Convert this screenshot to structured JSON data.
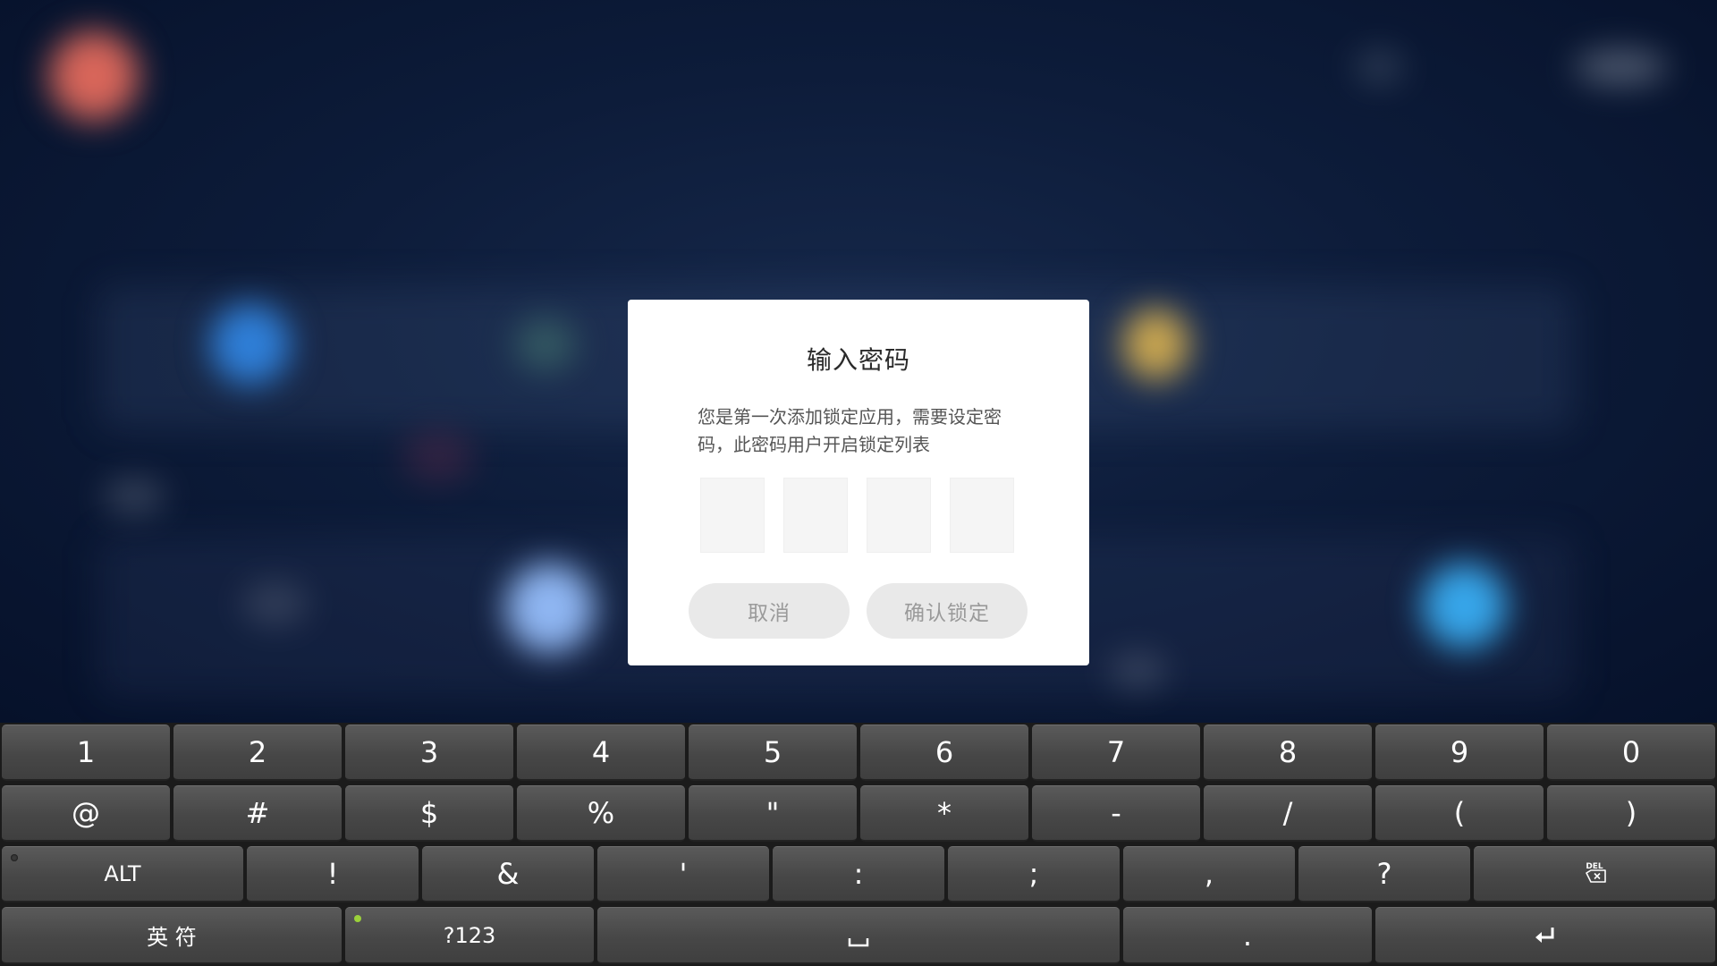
{
  "dialog": {
    "title": "输入密码",
    "message": "您是第一次添加锁定应用，需要设定密码，此密码用户开启锁定列表",
    "pin_boxes": [
      "",
      "",
      "",
      ""
    ],
    "cancel_label": "取消",
    "confirm_label": "确认锁定"
  },
  "keyboard": {
    "row1": [
      "1",
      "2",
      "3",
      "4",
      "5",
      "6",
      "7",
      "8",
      "9",
      "0"
    ],
    "row2": [
      "@",
      "#",
      "$",
      "%",
      "\"",
      "*",
      "-",
      "/",
      "(",
      ")"
    ],
    "row3": {
      "alt": "ALT",
      "symbols": [
        "!",
        "&",
        "'",
        ":",
        ";",
        ",",
        "?"
      ],
      "delete_icon": "delete-icon"
    },
    "row4": {
      "lang": "英 符",
      "mode": "?123",
      "space_icon": "space-icon",
      "period": ".",
      "enter_icon": "enter-icon"
    }
  },
  "colors": {
    "dialog_bg": "#ffffff",
    "button_bg": "#e9e9e9",
    "button_text": "#9a9a9a",
    "key_bg": "#4a4a4a",
    "keyboard_bg": "#1b1b1b",
    "mode_indicator": "#9bd13a"
  }
}
